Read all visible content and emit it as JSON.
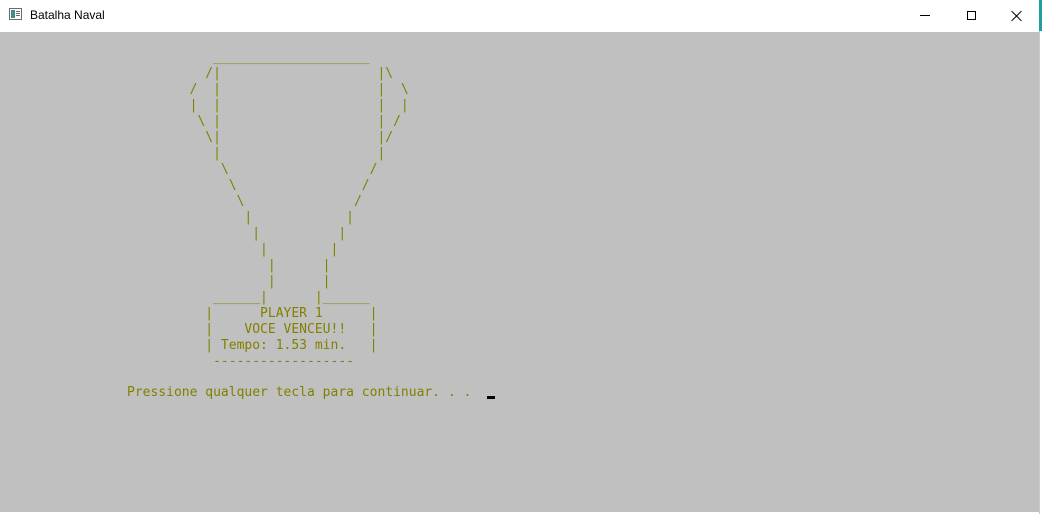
{
  "window": {
    "title": "Batalha Naval",
    "controls": {
      "minimize": "minimize",
      "maximize": "maximize",
      "close": "close"
    }
  },
  "console": {
    "background": "#c0c0c0",
    "text_color": "#808000",
    "trophy_art": "           ____________________\n          /|                    |\\\n        /  |                    |  \\\n        |  |                    |  |\n         \\ |                    | /\n          \\|                    |/\n           |                    |\n            \\                  /\n             \\                /\n              \\              /\n               |            |\n                |          |\n                 |        |\n                  |      |\n                  |      |\n           ______|      |______\n          |      PLAYER 1      |\n          |    VOCE VENCEU!!   |\n          | Tempo: 1.53 min.   |\n           ------------------",
    "prompt": "Pressione qualquer tecla para continuar. . ."
  }
}
